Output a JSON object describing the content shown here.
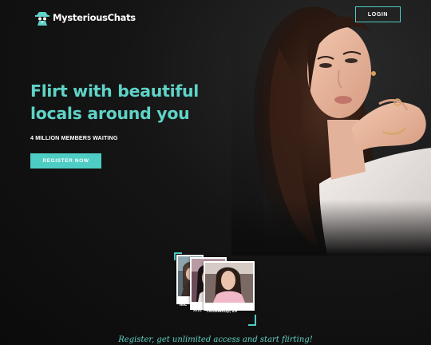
{
  "brand": {
    "name": "MysteriousChats",
    "logo_icon": "spy-agent-icon"
  },
  "header": {
    "login_label": "LOGIN"
  },
  "hero": {
    "headline_line1": "Flirt with beautiful",
    "headline_line2": "locals around you",
    "subhead": "4 MILLION MEMBERS WAITING",
    "register_label": "REGISTER NOW"
  },
  "profiles": [
    {
      "label": "Mic"
    },
    {
      "label": "And"
    },
    {
      "label": "HookMeUp, 24"
    }
  ],
  "footer": {
    "tagline": "Register, get unlimited access and start flirting!"
  },
  "colors": {
    "accent": "#4ecdc4",
    "headline": "#5fd3c7",
    "background": "#0c0c0c"
  }
}
